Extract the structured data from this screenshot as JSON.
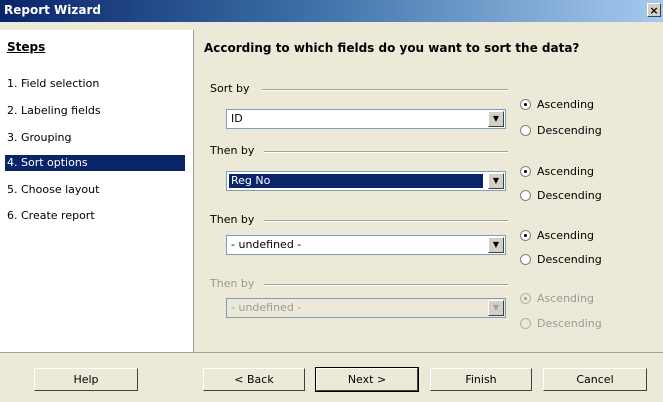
{
  "window": {
    "title": "Report Wizard",
    "close_glyph": "×"
  },
  "sidebar": {
    "heading": "Steps",
    "steps": [
      {
        "label": "1. Field selection"
      },
      {
        "label": "2. Labeling fields"
      },
      {
        "label": "3. Grouping"
      },
      {
        "label": "4. Sort options"
      },
      {
        "label": "5. Choose layout"
      },
      {
        "label": "6. Create report"
      }
    ],
    "active_index": 3
  },
  "main": {
    "question": "According to which fields do you want to sort the data?",
    "groups": [
      {
        "label": "Sort by",
        "field": "ID",
        "ascending": "Ascending",
        "descending": "Descending",
        "selected": "ascending",
        "enabled": true
      },
      {
        "label": "Then by",
        "field": "Reg No",
        "ascending": "Ascending",
        "descending": "Descending",
        "selected": "ascending",
        "enabled": true
      },
      {
        "label": "Then by",
        "field": "- undefined -",
        "ascending": "Ascending",
        "descending": "Descending",
        "selected": "ascending",
        "enabled": true
      },
      {
        "label": "Then by",
        "field": "- undefined -",
        "ascending": "Ascending",
        "descending": "Descending",
        "selected": "ascending",
        "enabled": false
      }
    ]
  },
  "footer": {
    "help": "Help",
    "back": "< Back",
    "next": "Next >",
    "finish": "Finish",
    "cancel": "Cancel"
  },
  "colors": {
    "titlebar_start": "#0a246a",
    "selection": "#0a246a",
    "dialog_bg": "#ece9d8"
  }
}
